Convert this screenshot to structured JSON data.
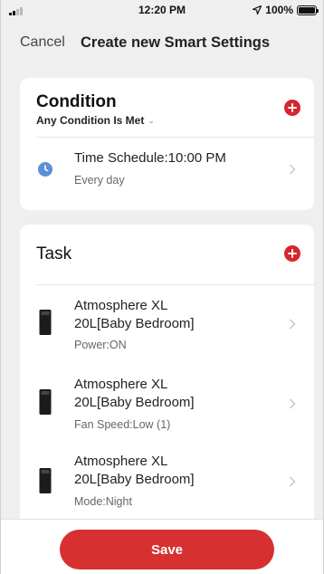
{
  "status_bar": {
    "time": "12:20 PM",
    "battery": "100%",
    "battery_level": 1.0
  },
  "nav": {
    "cancel_label": "Cancel",
    "title": "Create new Smart Settings"
  },
  "condition": {
    "title": "Condition",
    "match_mode": "Any Condition Is Met",
    "items": [
      {
        "label": "Time Schedule:10:00 PM",
        "detail": "Every day",
        "icon": "clock-icon"
      }
    ]
  },
  "task": {
    "title": "Task",
    "items": [
      {
        "name_line1": "Atmosphere XL",
        "name_line2": "20L[Baby Bedroom]",
        "detail": "Power:ON",
        "icon": "air-purifier-icon"
      },
      {
        "name_line1": "Atmosphere XL",
        "name_line2": "20L[Baby Bedroom]",
        "detail": "Fan Speed:Low (1)",
        "icon": "air-purifier-icon"
      },
      {
        "name_line1": "Atmosphere XL",
        "name_line2": "20L[Baby Bedroom]",
        "detail": "Mode:Night",
        "icon": "air-purifier-icon"
      }
    ]
  },
  "footer": {
    "save_label": "Save"
  },
  "colors": {
    "accent_red": "#d63030",
    "clock_blue": "#5b8fd9",
    "background": "#efefef"
  }
}
